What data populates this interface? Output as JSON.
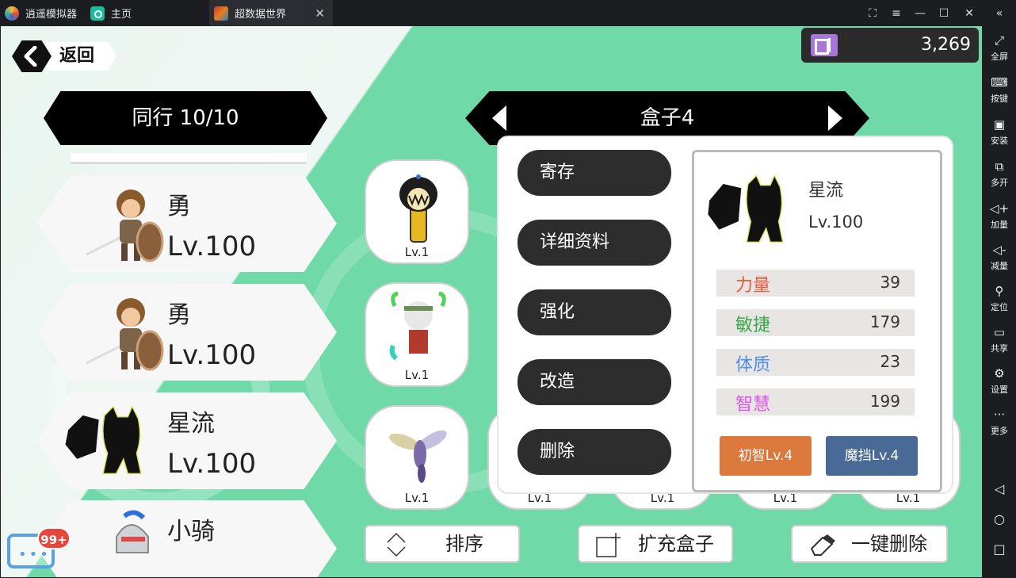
{
  "titlebar": {
    "app_tab": "逍遥模拟器",
    "home_tab": "主页",
    "game_tab": "超数据世界",
    "close_glyph": "✕",
    "controls": [
      "⛶",
      "≡",
      "—",
      "☐",
      "✕",
      "«"
    ]
  },
  "sidebar": {
    "items": [
      {
        "icon": "⤢",
        "label": "全屏"
      },
      {
        "icon": "⌨",
        "label": "按键"
      },
      {
        "icon": "▣",
        "label": "安装"
      },
      {
        "icon": "⧉",
        "label": "多开"
      },
      {
        "icon": "◁+",
        "label": "加量"
      },
      {
        "icon": "◁-",
        "label": "减量"
      },
      {
        "icon": "⚲",
        "label": "定位"
      },
      {
        "icon": "▭",
        "label": "共享"
      },
      {
        "icon": "⚙",
        "label": "设置"
      },
      {
        "icon": "···",
        "label": "更多"
      }
    ],
    "nav": [
      "◁",
      "○",
      "□"
    ]
  },
  "header": {
    "back_label": "返回",
    "currency_value": "3,269"
  },
  "party": {
    "title": "同行 10/10",
    "members": [
      {
        "name": "勇",
        "level": "Lv.100"
      },
      {
        "name": "勇",
        "level": "Lv.100"
      },
      {
        "name": "星流",
        "level": "Lv.100"
      },
      {
        "name": "小骑",
        "level": ""
      }
    ]
  },
  "box": {
    "title": "盒子4",
    "slots": [
      {
        "level": "Lv.1"
      },
      {
        "level": "Lv.1"
      },
      {
        "level": "Lv.1"
      },
      {
        "level": "Lv.1"
      },
      {
        "level": "Lv.1"
      },
      {
        "level": "Lv.1"
      },
      {
        "level": "Lv.1"
      }
    ]
  },
  "popup": {
    "menu": [
      "寄存",
      "详细资料",
      "强化",
      "改造",
      "删除"
    ],
    "detail": {
      "name": "星流",
      "level": "Lv.100",
      "stats": [
        {
          "label": "力量",
          "value": "39",
          "color": "#f05a3c"
        },
        {
          "label": "敏捷",
          "value": "179",
          "color": "#3aa84a"
        },
        {
          "label": "体质",
          "value": "23",
          "color": "#4f8fe8"
        },
        {
          "label": "智慧",
          "value": "199",
          "color": "#e056e8"
        }
      ],
      "skills": [
        {
          "label": "初智Lv.4",
          "color": "#dc7a3e"
        },
        {
          "label": "魔挡Lv.4",
          "color": "#4a6a96"
        }
      ]
    }
  },
  "bottom": {
    "sort_label": "排序",
    "expand_label": "扩充盒子",
    "delete_all_label": "一键删除"
  },
  "chat": {
    "badge": "99+"
  }
}
